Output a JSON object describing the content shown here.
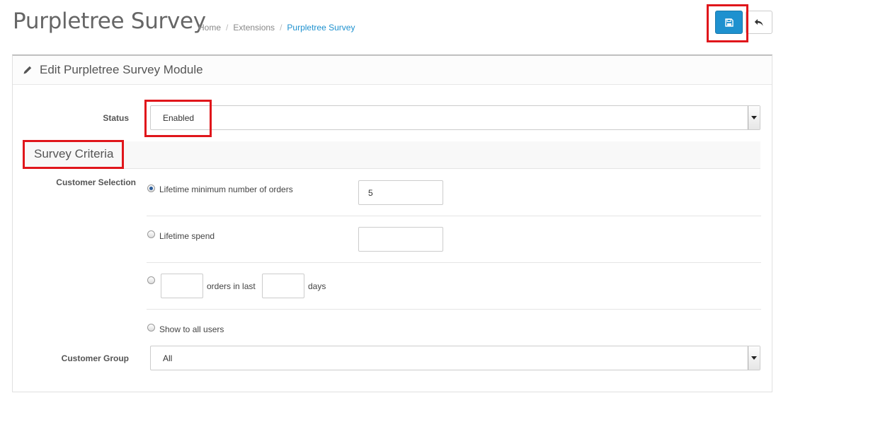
{
  "header": {
    "title": "Purpletree Survey",
    "breadcrumb": [
      {
        "label": "Home"
      },
      {
        "label": "Extensions"
      },
      {
        "label": "Purpletree Survey"
      }
    ],
    "separator": "/"
  },
  "panel": {
    "heading": "Edit Purpletree Survey Module"
  },
  "form": {
    "status": {
      "label": "Status",
      "value": "Enabled"
    },
    "section_title": "Survey Criteria",
    "customer_selection": {
      "label": "Customer Selection",
      "options": [
        {
          "label": "Lifetime minimum number of orders",
          "value": "5",
          "checked": true
        },
        {
          "label": "Lifetime spend",
          "value": "",
          "checked": false
        },
        {
          "label_mid": "orders in last",
          "label_end": "days",
          "orders_value": "",
          "days_value": "",
          "checked": false
        },
        {
          "label": "Show to all users",
          "checked": false
        }
      ]
    },
    "customer_group": {
      "label": "Customer Group",
      "value": "All"
    }
  },
  "colors": {
    "primary": "#1e91cf",
    "highlight": "#e0161b",
    "link": "#1e91cf"
  },
  "icons": {
    "save": "floppy-disk-icon",
    "back": "reply-arrow-icon",
    "edit": "pencil-icon"
  }
}
